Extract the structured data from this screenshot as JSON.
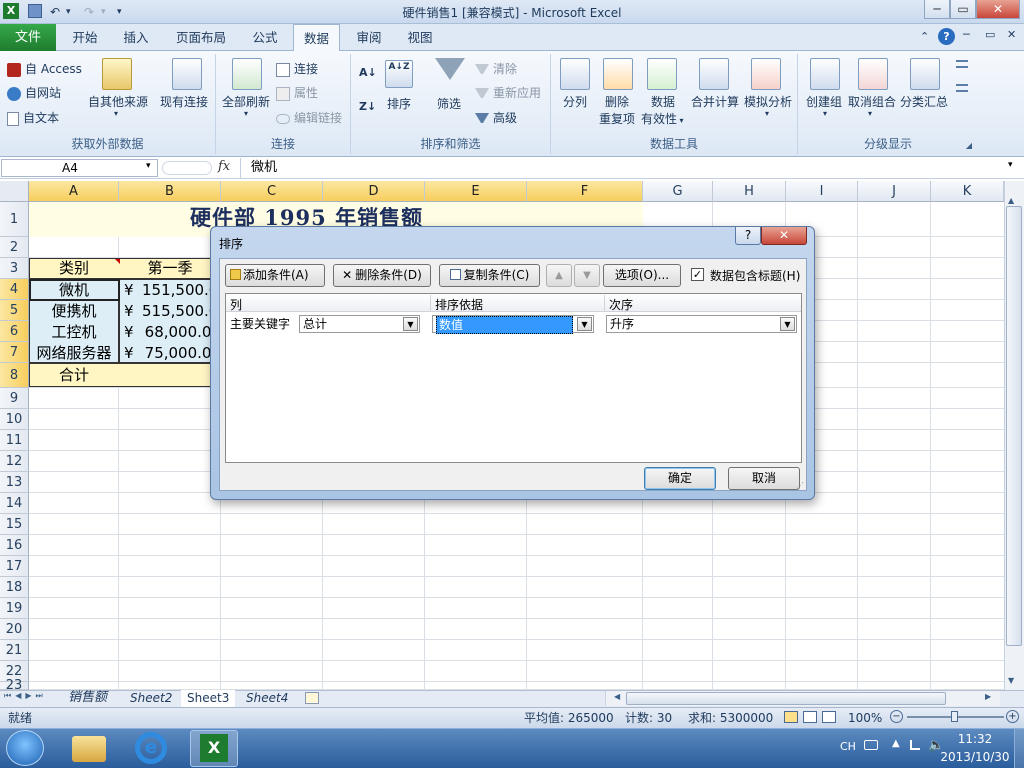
{
  "window": {
    "title": "硬件销售1 [兼容模式] - Microsoft Excel",
    "min": "─",
    "max": "▭",
    "close": "✕"
  },
  "qat": {
    "app_icon": "X",
    "undo": "↶",
    "redo": "↷",
    "more": "▾"
  },
  "tabs": [
    {
      "label": "文件"
    },
    {
      "label": "开始"
    },
    {
      "label": "插入"
    },
    {
      "label": "页面布局"
    },
    {
      "label": "公式"
    },
    {
      "label": "数据"
    },
    {
      "label": "审阅"
    },
    {
      "label": "视图"
    }
  ],
  "ribbon": {
    "ext": {
      "access": "自 Access",
      "web": "自网站",
      "text": "自文本",
      "other": "自其他来源",
      "existing": "现有连接",
      "label": "获取外部数据"
    },
    "conn": {
      "refresh": "全部刷新",
      "connections": "连接",
      "properties": "属性",
      "edit_links": "编辑链接",
      "label": "连接"
    },
    "sort": {
      "az": "A↓Z",
      "za": "Z↓A",
      "sort": "排序",
      "filter": "筛选",
      "clear": "清除",
      "reapply": "重新应用",
      "advanced": "高级",
      "label": "排序和筛选"
    },
    "tools": {
      "split": "分列",
      "remove_dup_1": "删除",
      "remove_dup_2": "重复项",
      "validation_1": "数据",
      "validation_2": "有效性",
      "consolidate": "合并计算",
      "whatif": "模拟分析",
      "label": "数据工具"
    },
    "outline": {
      "group": "创建组",
      "ungroup": "取消组合",
      "subtotal": "分类汇总",
      "label": "分级显示"
    }
  },
  "formula_bar": {
    "name_box": "A4",
    "fx": "fx",
    "content": "微机"
  },
  "columns": [
    "A",
    "B",
    "C",
    "D",
    "E",
    "F",
    "G",
    "H",
    "I",
    "J",
    "K"
  ],
  "rows": [
    "1",
    "2",
    "3",
    "4",
    "5",
    "6",
    "7",
    "8",
    "9",
    "10",
    "11",
    "12",
    "13",
    "14",
    "15",
    "16",
    "17",
    "18",
    "19",
    "20",
    "21",
    "22",
    "23"
  ],
  "cells": {
    "title": "硬件部 1995 年销售额",
    "hdr_category": "类别",
    "hdr_q1": "第一季",
    "r4a": "微机",
    "r4b_sym": "¥",
    "r4b": "151,500.00",
    "r5a": "便携机",
    "r5b_sym": "¥",
    "r5b": "515,500.00",
    "r6a": "工控机",
    "r6b_sym": "¥",
    "r6b": "68,000.00",
    "r7a": "网络服务器",
    "r7b_sym": "¥",
    "r7b": "75,000.00",
    "r8a": "合计"
  },
  "sheet_tabs": [
    "销售额",
    "Sheet2",
    "Sheet3",
    "Sheet4"
  ],
  "status": {
    "mode": "就绪",
    "average": "平均值: 265000",
    "count": "计数: 30",
    "sum": "求和: 5300000",
    "zoom": "100%"
  },
  "taskbar": {
    "lang": "CH",
    "time": "11:32",
    "date": "2013/10/30"
  },
  "dialog": {
    "title": "排序",
    "help": "?",
    "close": "✕",
    "add_level": "添加条件(A)",
    "delete_level": "删除条件(D)",
    "copy_level": "复制条件(C)",
    "options": "选项(O)...",
    "has_headers": "数据包含标题(H)",
    "col_header": "列",
    "sorton_header": "排序依据",
    "order_header": "次序",
    "row_label": "主要关键字",
    "column_value": "总计",
    "sorton_value": "数值",
    "order_value": "升序",
    "ok": "确定",
    "cancel": "取消"
  },
  "colors": {
    "title_band": "#fffde3",
    "header_fill": "#fff6c4",
    "data_fill": "#ddeef7",
    "selected_header": "#f7ce5d"
  }
}
